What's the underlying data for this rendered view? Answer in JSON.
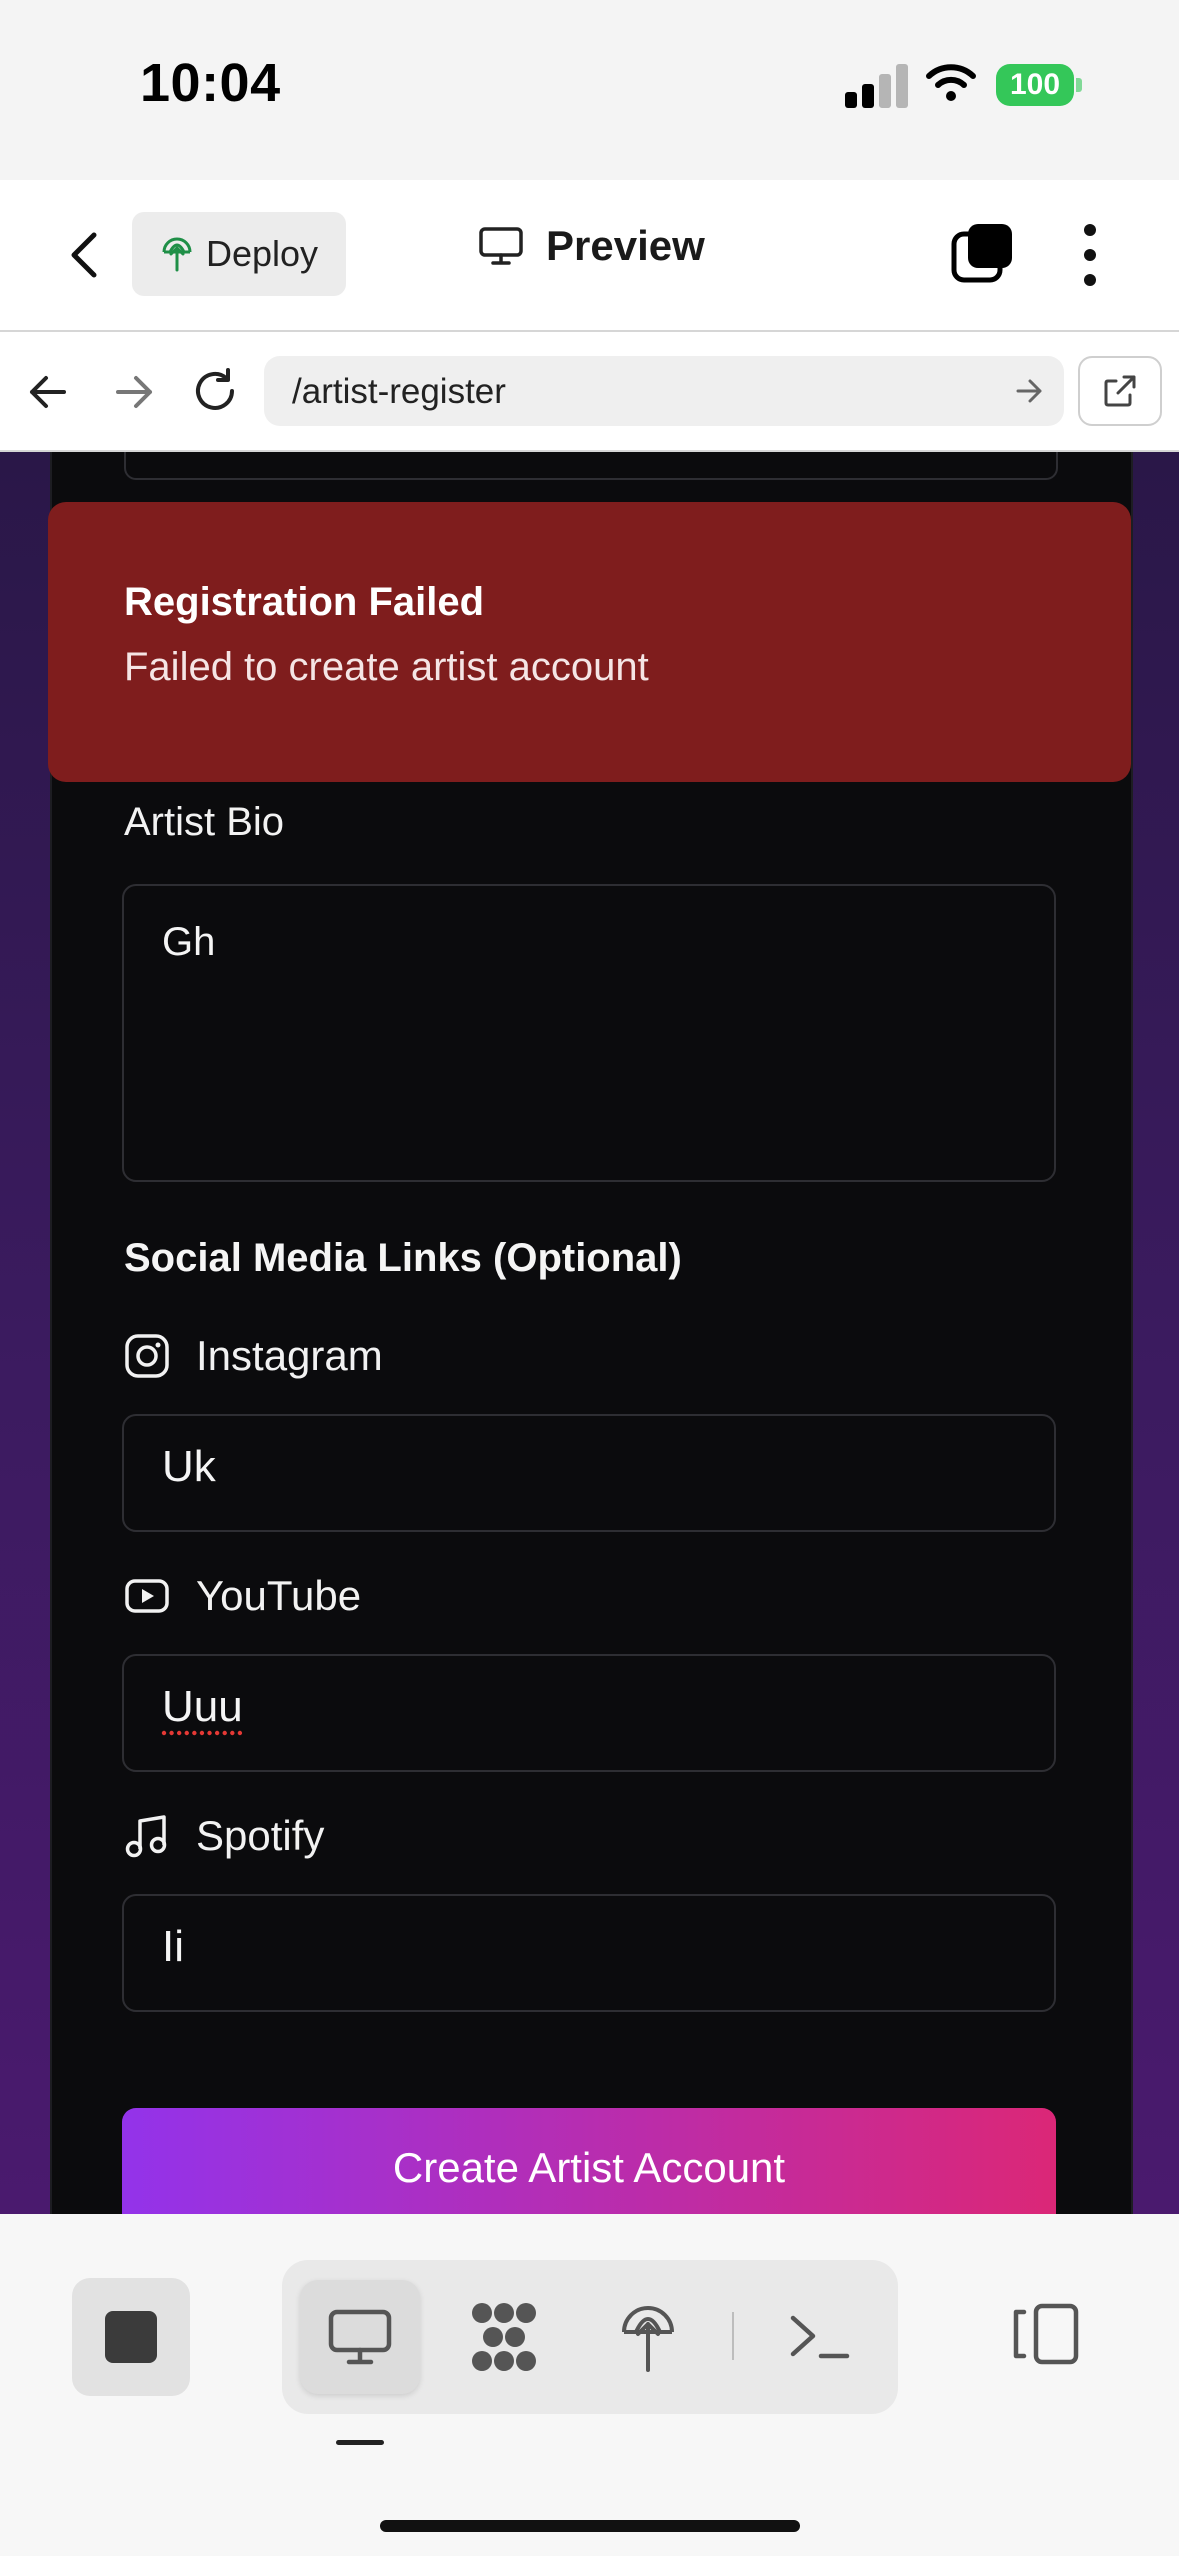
{
  "status_bar": {
    "time": "10:04",
    "battery": "100"
  },
  "header": {
    "deploy_label": "Deploy",
    "preview_label": "Preview"
  },
  "url_bar": {
    "url": "/artist-register"
  },
  "toast": {
    "title": "Registration Failed",
    "message": "Failed to create artist account"
  },
  "form": {
    "bio_label": "Artist Bio",
    "bio_value": "Gh",
    "social_title": "Social Media Links (Optional)",
    "instagram_label": "Instagram",
    "instagram_value": "Uk",
    "youtube_label": "YouTube",
    "youtube_value": "Uuu",
    "spotify_label": "Spotify",
    "spotify_value": "Ii",
    "submit_label": "Create Artist Account"
  },
  "colors": {
    "toast_bg": "#7f1d1d",
    "card_bg": "#0b0b0d",
    "button_gradient_start": "#9333ea",
    "button_gradient_end": "#db2777",
    "battery": "#34c759"
  },
  "icons": {
    "header": [
      "back-chevron-icon",
      "deploy-icon",
      "monitor-icon",
      "tabs-icon",
      "more-vertical-icon"
    ],
    "url_bar": [
      "arrow-left-icon",
      "arrow-right-icon",
      "reload-icon",
      "go-arrow-icon",
      "external-link-icon"
    ],
    "form": [
      "instagram-icon",
      "youtube-icon",
      "music-note-icon"
    ],
    "toolbar": [
      "stop-icon",
      "monitor-icon",
      "workflow-icon",
      "deploy-icon",
      "terminal-icon",
      "split-layout-icon"
    ]
  }
}
